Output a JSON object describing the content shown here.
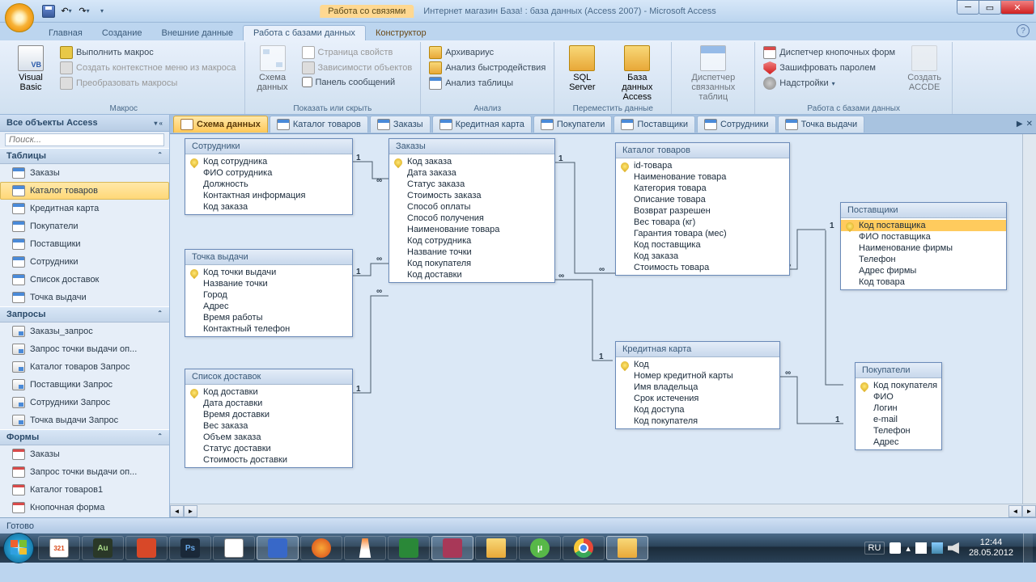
{
  "title": {
    "contextual": "Работа со связями",
    "app": "Интернет магазин База! : база данных (Access 2007) - Microsoft Access"
  },
  "tabs": {
    "home": "Главная",
    "create": "Создание",
    "external": "Внешние данные",
    "dbtools": "Работа с базами данных",
    "constructor": "Конструктор"
  },
  "ribbon": {
    "g_macro": "Макрос",
    "g_show": "Показать или скрыть",
    "g_analyze": "Анализ",
    "g_move": "Переместить данные",
    "g_dbt": "Работа с базами данных",
    "vb": "Visual Basic",
    "run_macro": "Выполнить макрос",
    "ctx_macro": "Создать контекстное меню из макроса",
    "conv_macro": "Преобразовать макросы",
    "schema": "Схема данных",
    "prop_page": "Страница свойств",
    "deps": "Зависимости объектов",
    "msgbar": "Панель сообщений",
    "archiv": "Архивариус",
    "perf": "Анализ быстродействия",
    "analtbl": "Анализ таблицы",
    "sql": "SQL Server",
    "accdb": "База данных Access",
    "linked": "Диспетчер связанных таблиц",
    "switchmgr": "Диспетчер кнопочных форм",
    "encrypt": "Зашифровать паролем",
    "addins": "Надстройки",
    "accde": "Создать ACCDE"
  },
  "doc_tabs": [
    "Схема данных",
    "Каталог товаров",
    "Заказы",
    "Кредитная карта",
    "Покупатели",
    "Поставщики",
    "Сотрудники",
    "Точка выдачи"
  ],
  "nav": {
    "header": "Все объекты Access",
    "g_tables": "Таблицы",
    "g_queries": "Запросы",
    "g_forms": "Формы",
    "tables": [
      "Заказы",
      "Каталог товаров",
      "Кредитная карта",
      "Покупатели",
      "Поставщики",
      "Сотрудники",
      "Список доставок",
      "Точка выдачи"
    ],
    "queries": [
      "Заказы_запрос",
      "Запрос точки выдачи оп...",
      "Каталог товаров Запрос",
      "Поставщики Запрос",
      "Сотрудники Запрос",
      "Точка выдачи Запрос"
    ],
    "forms": [
      "Заказы",
      "Запрос точки выдачи оп...",
      "Каталог товаров1",
      "Кнопочная форма"
    ]
  },
  "entities": {
    "employees": {
      "title": "Сотрудники",
      "fields": [
        "Код сотрудника",
        "ФИО сотрудника",
        "Должность",
        "Контактная информация",
        "Код заказа"
      ],
      "pk": [
        0
      ]
    },
    "pickup": {
      "title": "Точка выдачи",
      "fields": [
        "Код точки выдачи",
        "Название точки",
        "Город",
        "Адрес",
        "Время работы",
        "Контактный телефон"
      ],
      "pk": [
        0
      ]
    },
    "delivery": {
      "title": "Список доставок",
      "fields": [
        "Код доставки",
        "Дата доставки",
        "Время доставки",
        "Вес заказа",
        "Объем заказа",
        "Статус доставки",
        "Стоимость доставки"
      ],
      "pk": [
        0
      ]
    },
    "orders": {
      "title": "Заказы",
      "fields": [
        "Код заказа",
        "Дата заказа",
        "Статус заказа",
        "Стоимость заказа",
        "Способ оплаты",
        "Способ получения",
        "Наименование товара",
        "Код сотрудника",
        "Название точки",
        "Код покупателя",
        "Код доставки"
      ],
      "pk": [
        0
      ]
    },
    "catalog": {
      "title": "Каталог товаров",
      "fields": [
        "id-товара",
        "Наименование товара",
        "Категория товара",
        "Описание товара",
        "Возврат разрешен",
        "Вес товара (кг)",
        "Гарантия товара (мес)",
        "Код поставщика",
        "Код заказа",
        "Стоимость товара"
      ],
      "pk": [
        0
      ]
    },
    "card": {
      "title": "Кредитная карта",
      "fields": [
        "Код",
        "Номер кредитной карты",
        "Имя владельца",
        "Срок истечения",
        "Код доступа",
        "Код покупателя"
      ],
      "pk": [
        0
      ]
    },
    "suppliers": {
      "title": "Поставщики",
      "fields": [
        "Код поставщика",
        "ФИО поставщика",
        "Наименование фирмы",
        "Телефон",
        "Адрес фирмы",
        "Код товара"
      ],
      "pk": [
        0
      ]
    },
    "customers": {
      "title": "Покупатели",
      "fields": [
        "Код покупателя",
        "ФИО",
        "Логин",
        "e-mail",
        "Телефон",
        "Адрес"
      ],
      "pk": [
        0
      ]
    }
  },
  "status": "Готово",
  "tray": {
    "lang": "RU",
    "time": "12:44",
    "date": "28.05.2012"
  }
}
